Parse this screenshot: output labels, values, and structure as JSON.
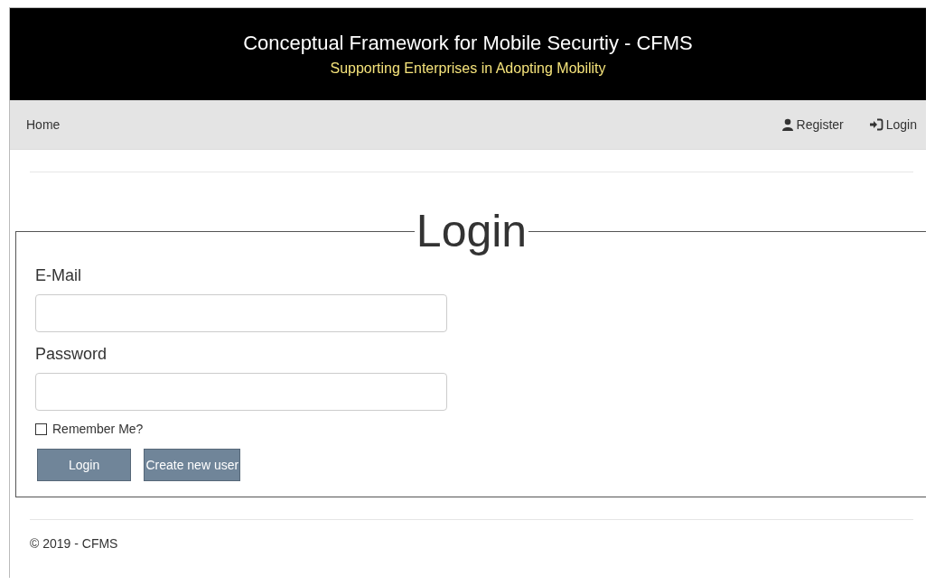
{
  "header": {
    "title": "Conceptual Framework for Mobile Securtiy - CFMS",
    "subtitle": "Supporting Enterprises in Adopting Mobility"
  },
  "nav": {
    "left": [
      {
        "label": "Home"
      }
    ],
    "right": [
      {
        "label": "Register",
        "kind": "user"
      },
      {
        "label": "Login",
        "kind": "login"
      }
    ]
  },
  "form": {
    "legend": "Login",
    "fields": [
      {
        "label": "E-Mail"
      },
      {
        "label": "Password"
      }
    ],
    "remember": {
      "label": "Remember Me?",
      "checked": false
    },
    "buttons": [
      {
        "label": "Login"
      },
      {
        "label": "Create new user"
      }
    ]
  },
  "footer": {
    "text": "© 2019 - CFMS"
  }
}
